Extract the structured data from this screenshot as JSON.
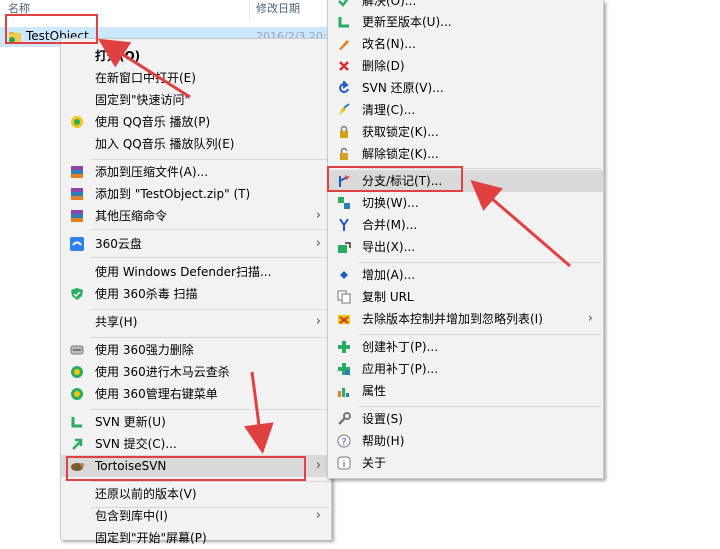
{
  "explorer": {
    "col_name": "名称",
    "col_date": "修改日期",
    "file": {
      "name": "TestObject",
      "date": "2016/2/3 20:"
    }
  },
  "context_menu": {
    "items": [
      {
        "label": "打开(O)",
        "icon": "",
        "bold": true
      },
      {
        "label": "在新窗口中打开(E)",
        "icon": ""
      },
      {
        "label": "固定到\"快速访问\"",
        "icon": ""
      },
      {
        "label": "使用 QQ音乐 播放(P)",
        "icon": "qq-music-icon"
      },
      {
        "label": "加入 QQ音乐 播放队列(E)",
        "icon": ""
      },
      {
        "label": "添加到压缩文件(A)...",
        "icon": "archive-icon"
      },
      {
        "label": "添加到 \"TestObject.zip\" (T)",
        "icon": "archive-icon"
      },
      {
        "label": "其他压缩命令",
        "icon": "archive-icon",
        "submenu": true
      },
      {
        "label": "360云盘",
        "icon": "cloud-disk-icon",
        "submenu": true
      },
      {
        "label": "使用 Windows Defender扫描...",
        "icon": ""
      },
      {
        "label": "使用 360杀毒 扫描",
        "icon": "antivirus-icon"
      },
      {
        "label": "共享(H)",
        "icon": "",
        "submenu": true
      },
      {
        "label": "使用 360强力删除",
        "icon": "shredder-icon"
      },
      {
        "label": "使用 360进行木马云查杀",
        "icon": "trojan-scan-icon"
      },
      {
        "label": "使用 360管理右键菜单",
        "icon": "menu-manager-icon"
      },
      {
        "label": "SVN 更新(U)",
        "icon": "svn-update-icon"
      },
      {
        "label": "SVN 提交(C)...",
        "icon": "svn-commit-icon"
      },
      {
        "label": "TortoiseSVN",
        "icon": "tortoise-icon",
        "submenu": true
      },
      {
        "label": "还原以前的版本(V)",
        "icon": ""
      },
      {
        "label": "包含到库中(I)",
        "icon": "",
        "submenu": true
      },
      {
        "label": "固定到\"开始\"屏幕(P)",
        "icon": ""
      }
    ]
  },
  "submenu": {
    "items": [
      {
        "label": "解决(O)...",
        "icon": "resolve-icon"
      },
      {
        "label": "更新至版本(U)...",
        "icon": "update-revision-icon"
      },
      {
        "label": "改名(N)...",
        "icon": "rename-icon"
      },
      {
        "label": "删除(D)",
        "icon": "delete-icon"
      },
      {
        "label": "SVN 还原(V)...",
        "icon": "revert-icon"
      },
      {
        "label": "清理(C)...",
        "icon": "cleanup-icon"
      },
      {
        "label": "获取锁定(K)...",
        "icon": "lock-icon"
      },
      {
        "label": "解除锁定(K)...",
        "icon": "unlock-icon"
      },
      {
        "label": "分支/标记(T)...",
        "icon": "branch-tag-icon"
      },
      {
        "label": "切换(W)...",
        "icon": "switch-icon"
      },
      {
        "label": "合并(M)...",
        "icon": "merge-icon"
      },
      {
        "label": "导出(X)...",
        "icon": "export-icon"
      },
      {
        "label": "增加(A)...",
        "icon": "add-icon"
      },
      {
        "label": "复制 URL",
        "icon": "copy-url-icon"
      },
      {
        "label": "去除版本控制并增加到忽略列表(I)",
        "icon": "ignore-icon",
        "submenu": true
      },
      {
        "label": "创建补丁(P)...",
        "icon": "create-patch-icon"
      },
      {
        "label": "应用补丁(P)...",
        "icon": "apply-patch-icon"
      },
      {
        "label": "属性",
        "icon": "properties-icon"
      },
      {
        "label": "设置(S)",
        "icon": "settings-icon"
      },
      {
        "label": "帮助(H)",
        "icon": "help-icon"
      },
      {
        "label": "关于",
        "icon": "about-icon"
      }
    ]
  },
  "colors": {
    "highlight_box": "#e04040",
    "menu_bg": "#f2f2f2",
    "selection": "#cce8ff"
  }
}
